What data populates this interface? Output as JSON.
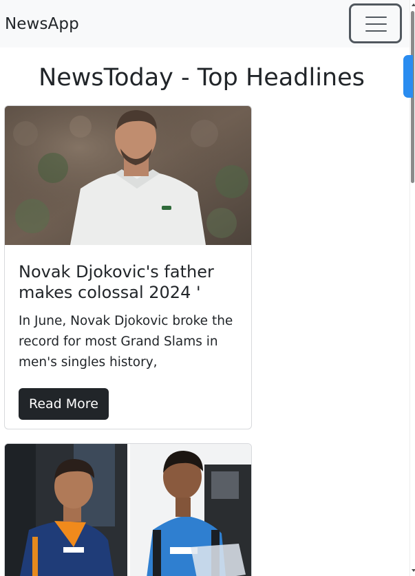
{
  "navbar": {
    "brand": "NewsApp",
    "toggler_icon": "hamburger-menu-icon"
  },
  "page": {
    "heading": "NewsToday - Top Headlines"
  },
  "articles": [
    {
      "image": "tennis-player-photo",
      "title": "Novak Djokovic's father makes colossal 2024 '",
      "description": "In June, Novak Djokovic broke the record for most Grand Slams in men's singles history,",
      "button_label": "Read More"
    },
    {
      "image": "cricket-players-photo"
    }
  ],
  "colors": {
    "navbar_bg": "#f8f9fa",
    "button_bg": "#212529",
    "text": "#212529",
    "card_border": "#d7d9dc",
    "scroll_thumb_accent": "#2a8cf0"
  }
}
